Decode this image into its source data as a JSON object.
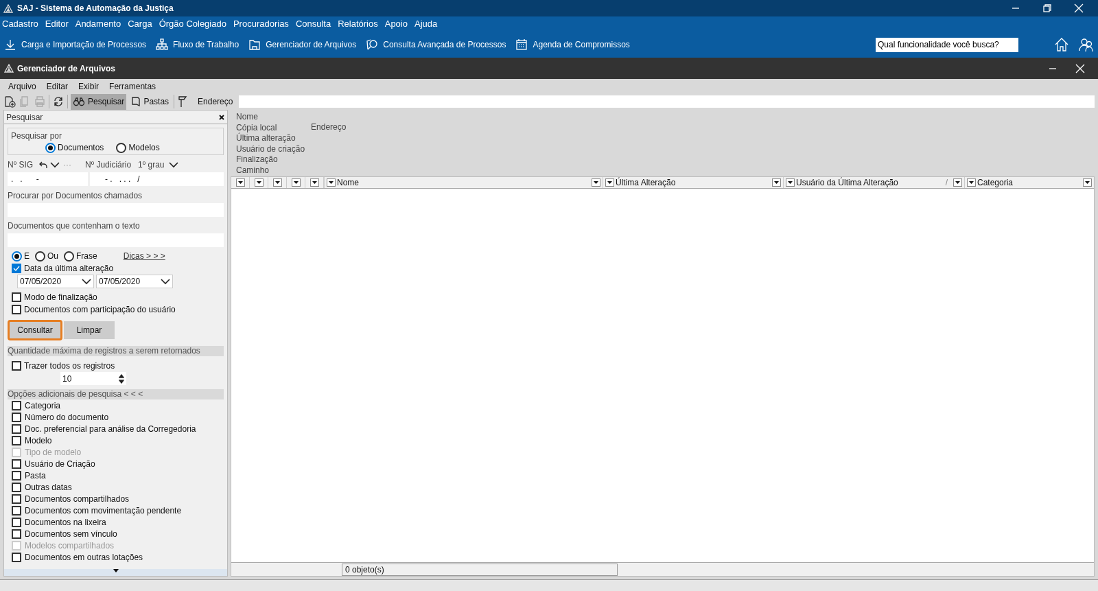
{
  "window": {
    "title": "SAJ - Sistema de Automação da Justiça"
  },
  "menu": [
    "Cadastro",
    "Editor",
    "Andamento",
    "Carga",
    "Órgão Colegiado",
    "Procuradorias",
    "Consulta",
    "Relatórios",
    "Apoio",
    "Ajuda"
  ],
  "quick_links": [
    {
      "kind": "download",
      "label": "Carga e Importação de Processos"
    },
    {
      "kind": "flow",
      "label": "Fluxo de Trabalho"
    },
    {
      "kind": "folder",
      "label": "Gerenciador de Arquivos"
    },
    {
      "kind": "search",
      "label": "Consulta Avançada de Processos"
    },
    {
      "kind": "calendar",
      "label": "Agenda de Compromissos"
    }
  ],
  "search": {
    "value": "Qual funcionalidade você busca?"
  },
  "subwindow": {
    "title": "Gerenciador de Arquivos"
  },
  "sub_menu": [
    "Arquivo",
    "Editar",
    "Exibir",
    "Ferramentas"
  ],
  "toolbar_tabs": [
    {
      "kind": "search",
      "label": "Pesquisar",
      "selected": true
    },
    {
      "kind": "folder",
      "label": "Pastas",
      "selected": false
    }
  ],
  "address_label": "Endereço",
  "panel": {
    "title": "Pesquisar",
    "search_by": {
      "label": "Pesquisar por",
      "options": [
        {
          "label": "Documentos",
          "selected": true
        },
        {
          "label": "Modelos",
          "selected": false
        }
      ]
    },
    "sig_label": "Nº SIG",
    "sig_more": "···",
    "sig_value": ".   .      -",
    "judicial_label": "Nº Judiciário",
    "grade": "1º grau",
    "judicial_value": "- .   . . .   /",
    "text_fields": [
      {
        "label": "Procurar por Documentos chamados"
      },
      {
        "label": "Documentos que contenham o texto"
      }
    ],
    "match_modes": [
      {
        "label": "E",
        "selected": true
      },
      {
        "label": "Ou",
        "selected": false
      },
      {
        "label": "Frase",
        "selected": false
      }
    ],
    "tips_link": "Dicas > > >",
    "date_filter": {
      "label": "Data da última alteração",
      "checked": true,
      "from": "07/05/2020",
      "to": "07/05/2020"
    },
    "checks": [
      {
        "label": "Modo de finalização",
        "checked": false
      },
      {
        "label": "Documentos com participação do usuário",
        "checked": false
      }
    ],
    "buttons": [
      {
        "label": "Consultar",
        "focused": true
      },
      {
        "label": "Limpar",
        "focused": false
      }
    ],
    "max_section": {
      "title": "Quantidade máxima de registros a serem retornados",
      "check_label": "Trazer todos os registros",
      "checked": false,
      "value": "10"
    },
    "extra": {
      "title": "Opções adicionais de pesquisa < < <",
      "items": [
        {
          "label": "Categoria",
          "checked": false,
          "disabled": false
        },
        {
          "label": "Número do documento",
          "checked": false,
          "disabled": false
        },
        {
          "label": "Doc. preferencial para análise da Corregedoria",
          "checked": false,
          "disabled": false
        },
        {
          "label": "Modelo",
          "checked": false,
          "disabled": false
        },
        {
          "label": "Tipo de modelo",
          "checked": false,
          "disabled": true
        },
        {
          "label": "Usuário de Criação",
          "checked": false,
          "disabled": false
        },
        {
          "label": "Pasta",
          "checked": false,
          "disabled": false
        },
        {
          "label": "Outras datas",
          "checked": false,
          "disabled": false
        },
        {
          "label": "Documentos compartilhados",
          "checked": false,
          "disabled": false
        },
        {
          "label": "Documentos com movimentação pendente",
          "checked": false,
          "disabled": false
        },
        {
          "label": "Documentos na lixeira",
          "checked": false,
          "disabled": false
        },
        {
          "label": "Documentos sem vínculo",
          "checked": false,
          "disabled": false
        },
        {
          "label": "Modelos compartilhados",
          "checked": false,
          "disabled": true
        },
        {
          "label": "Documentos em outras lotações",
          "checked": false,
          "disabled": false
        }
      ]
    }
  },
  "details": {
    "labels": [
      "Nome",
      "Cópia local",
      "Última alteração",
      "Usuário de criação",
      "Finalização",
      "Caminho"
    ],
    "address": "Endereço"
  },
  "table": {
    "columns": [
      {
        "label": "Nome"
      },
      {
        "label": "Última Alteração"
      },
      {
        "label": "Usuário da Última Alteração",
        "mark": "/"
      },
      {
        "label": "Categoria"
      }
    ]
  },
  "object_count": "0 objeto(s)"
}
